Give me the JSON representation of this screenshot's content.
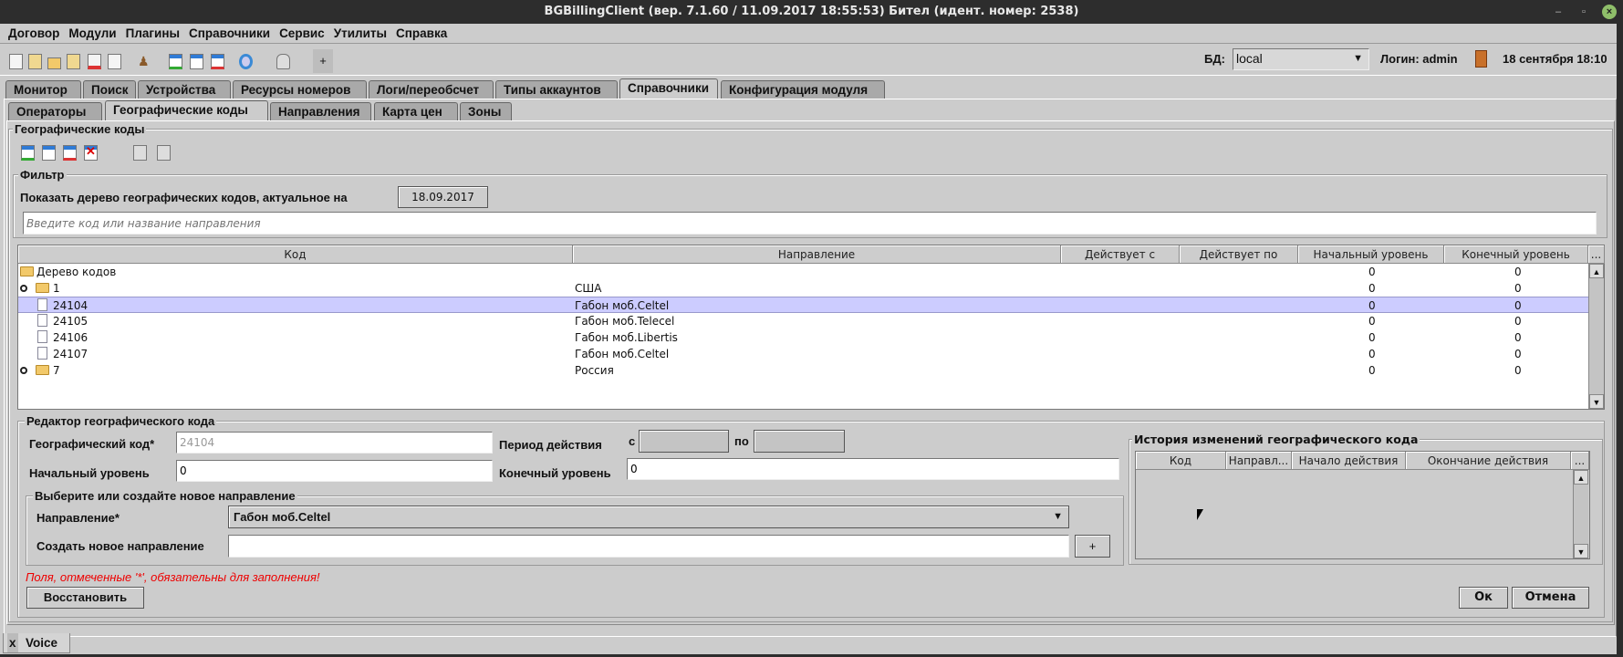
{
  "window": {
    "title": "BGBillingClient (вер. 7.1.60 / 11.09.2017 18:55:53) Бител (идент. номер: 2538)"
  },
  "menu": [
    "Договор",
    "Модули",
    "Плагины",
    "Справочники",
    "Сервис",
    "Утилиты",
    "Справка"
  ],
  "toolbar": {
    "plus_label": "+",
    "db_label": "БД:",
    "db_value": "local",
    "login": "Логин: admin",
    "datetime": "18 сентября 18:10"
  },
  "main_tabs": [
    "Монитор",
    "Поиск",
    "Устройства",
    "Ресурсы номеров",
    "Логи/переобсчет",
    "Типы аккаунтов",
    "Справочники",
    "Конфигурация модуля"
  ],
  "sub_tabs": [
    "Операторы",
    "Географические коды",
    "Направления",
    "Карта цен",
    "Зоны"
  ],
  "panel": {
    "title": "Географические коды"
  },
  "filter": {
    "title": "Фильтр",
    "label": "Показать дерево географических кодов, актуальное на",
    "date": "18.09.2017",
    "placeholder": "Введите код или название направления"
  },
  "table": {
    "columns": [
      "Код",
      "Направление",
      "Действует с",
      "Действует по",
      "Начальный уровень",
      "Конечный уровень",
      "..."
    ],
    "rows": [
      {
        "code": "Дерево кодов",
        "dir": "",
        "start": "0",
        "end": "0"
      },
      {
        "code": "1",
        "dir": "США",
        "start": "0",
        "end": "0"
      },
      {
        "code": "24104",
        "dir": "Габон моб.Celtel",
        "start": "0",
        "end": "0"
      },
      {
        "code": "24105",
        "dir": "Габон моб.Telecel",
        "start": "0",
        "end": "0"
      },
      {
        "code": "24106",
        "dir": "Габон моб.Libertis",
        "start": "0",
        "end": "0"
      },
      {
        "code": "24107",
        "dir": "Габон моб.Celtel",
        "start": "0",
        "end": "0"
      },
      {
        "code": "7",
        "dir": "Россия",
        "start": "0",
        "end": "0"
      }
    ]
  },
  "editor": {
    "title": "Редактор географического кода",
    "code_label": "Географический код*",
    "code_value": "24104",
    "period_label": "Период действия",
    "from_label": "с",
    "to_label": "по",
    "start_label": "Начальный уровень",
    "start_value": "0",
    "end_label": "Конечный уровень",
    "end_value": "0",
    "dir_group": "Выберите или создайте новое направление",
    "dir_label": "Направление*",
    "dir_value": "Габон моб.Celtel",
    "new_dir_label": "Создать новое направление",
    "add_label": "+",
    "required_note": "Поля, отмеченные '*', обязательны для заполнения!",
    "restore": "Восстановить",
    "ok": "Ок",
    "cancel": "Отмена"
  },
  "history": {
    "title": "История изменений географического кода",
    "columns": [
      "Код",
      "Направл...",
      "Начало действия",
      "Окончание действия",
      "..."
    ]
  },
  "bottom_tab": {
    "close": "x",
    "label": "Voice"
  }
}
